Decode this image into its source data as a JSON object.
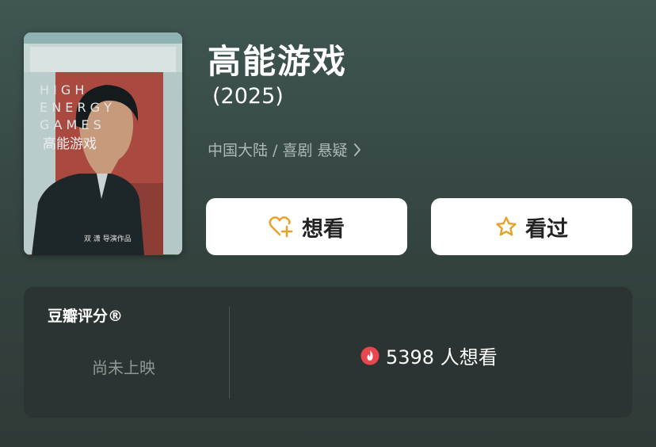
{
  "movie": {
    "title": "高能游戏",
    "year": "(2025)",
    "meta": "中国大陆 / 喜剧 悬疑",
    "poster": {
      "title_lines": [
        "H I G H",
        "E N E R G Y",
        "G A M E S"
      ],
      "cn_title": "高能游戏",
      "credit": "双 潇 导演作品"
    }
  },
  "actions": {
    "want_label": "想看",
    "seen_label": "看过"
  },
  "rating": {
    "label": "豆瓣评分®",
    "status": "尚未上映",
    "want_count": "5398 人想看"
  },
  "icons": {
    "meta_chevron": "chevron-right-icon",
    "want": "heart-plus-icon",
    "seen": "star-icon",
    "count": "flame-icon"
  },
  "colors": {
    "accent_gold": "#e8a326",
    "flame_red": "#e8474f"
  }
}
